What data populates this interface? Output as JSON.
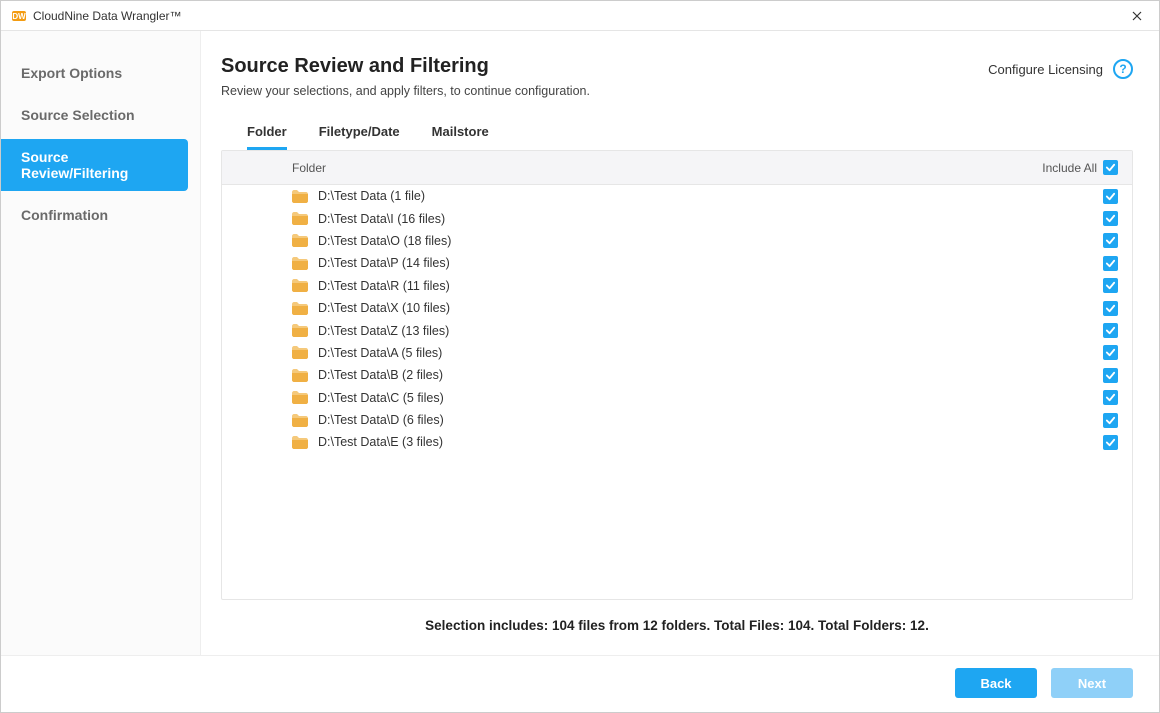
{
  "titlebar": {
    "title": "CloudNine Data Wrangler™"
  },
  "sidebar": {
    "items": [
      {
        "label": "Export Options",
        "active": false
      },
      {
        "label": "Source Selection",
        "active": false
      },
      {
        "label": "Source Review/Filtering",
        "active": true
      },
      {
        "label": "Confirmation",
        "active": false
      }
    ]
  },
  "header": {
    "title": "Source Review and Filtering",
    "subtitle": "Review your selections, and apply filters, to continue configuration.",
    "configure_link": "Configure Licensing"
  },
  "tabs": [
    {
      "label": "Folder",
      "active": true
    },
    {
      "label": "Filetype/Date",
      "active": false
    },
    {
      "label": "Mailstore",
      "active": false
    }
  ],
  "table": {
    "col_folder": "Folder",
    "col_include_all": "Include All",
    "rows": [
      {
        "label": "D:\\Test Data (1 file)",
        "checked": true
      },
      {
        "label": "D:\\Test Data\\I (16 files)",
        "checked": true
      },
      {
        "label": "D:\\Test Data\\O (18 files)",
        "checked": true
      },
      {
        "label": "D:\\Test Data\\P (14 files)",
        "checked": true
      },
      {
        "label": "D:\\Test Data\\R (11 files)",
        "checked": true
      },
      {
        "label": "D:\\Test Data\\X (10 files)",
        "checked": true
      },
      {
        "label": "D:\\Test Data\\Z (13 files)",
        "checked": true
      },
      {
        "label": "D:\\Test Data\\A (5 files)",
        "checked": true
      },
      {
        "label": "D:\\Test Data\\B (2 files)",
        "checked": true
      },
      {
        "label": "D:\\Test Data\\C (5 files)",
        "checked": true
      },
      {
        "label": "D:\\Test Data\\D (6 files)",
        "checked": true
      },
      {
        "label": "D:\\Test Data\\E (3 files)",
        "checked": true
      }
    ]
  },
  "summary": "Selection includes: 104 files from 12 folders. Total Files: 104. Total Folders: 12.",
  "buttons": {
    "back": "Back",
    "next": "Next"
  }
}
